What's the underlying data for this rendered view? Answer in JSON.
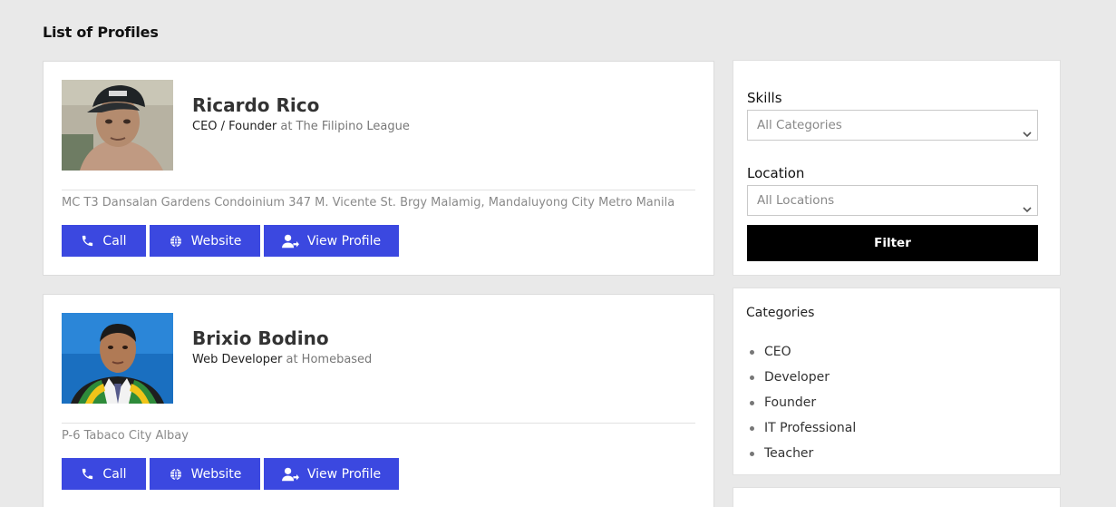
{
  "page": {
    "title": "List of Profiles"
  },
  "profiles": [
    {
      "name": "Ricardo Rico",
      "role": "CEO / Founder",
      "at_text": "at The Filipino League",
      "address": "MC T3 Dansalan Gardens Condoinium 347 M. Vicente St. Brgy Malamig, Mandaluyong City Metro Manila",
      "buttons": {
        "call": "Call",
        "website": "Website",
        "view": "View Profile"
      }
    },
    {
      "name": "Brixio Bodino",
      "role": "Web Developer",
      "at_text": "at Homebased",
      "address": "P-6 Tabaco City Albay",
      "buttons": {
        "call": "Call",
        "website": "Website",
        "view": "View Profile"
      }
    }
  ],
  "filter": {
    "skills_label": "Skills",
    "skills_value": "All Categories",
    "location_label": "Location",
    "location_value": "All Locations",
    "button_label": "Filter"
  },
  "categories": {
    "title": "Categories",
    "items": [
      "CEO",
      "Developer",
      "Founder",
      "IT Professional",
      "Teacher"
    ]
  },
  "colors": {
    "accent": "#3b48e0",
    "background": "#e9e9e9",
    "filter_button": "#000000"
  },
  "icons": {
    "call": "phone-icon",
    "website": "globe-icon",
    "view": "user-arrow-icon",
    "select": "chevron-down-icon"
  }
}
